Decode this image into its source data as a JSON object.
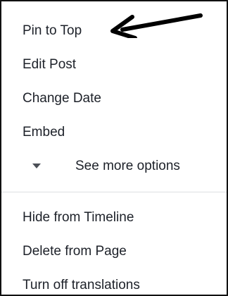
{
  "menu": {
    "items_top": [
      {
        "label": "Pin to Top"
      },
      {
        "label": "Edit Post"
      },
      {
        "label": "Change Date"
      },
      {
        "label": "Embed"
      }
    ],
    "more": {
      "label": "See more options",
      "icon": "caret-down-icon"
    },
    "items_bottom": [
      {
        "label": "Hide from Timeline"
      },
      {
        "label": "Delete from Page"
      },
      {
        "label": "Turn off translations"
      }
    ]
  },
  "annotation": {
    "icon": "arrow-left-icon",
    "color": "#000000"
  },
  "colors": {
    "text": "#1d2129",
    "border": "#111111",
    "divider": "#dddfe2",
    "caret": "#4b4f56"
  }
}
